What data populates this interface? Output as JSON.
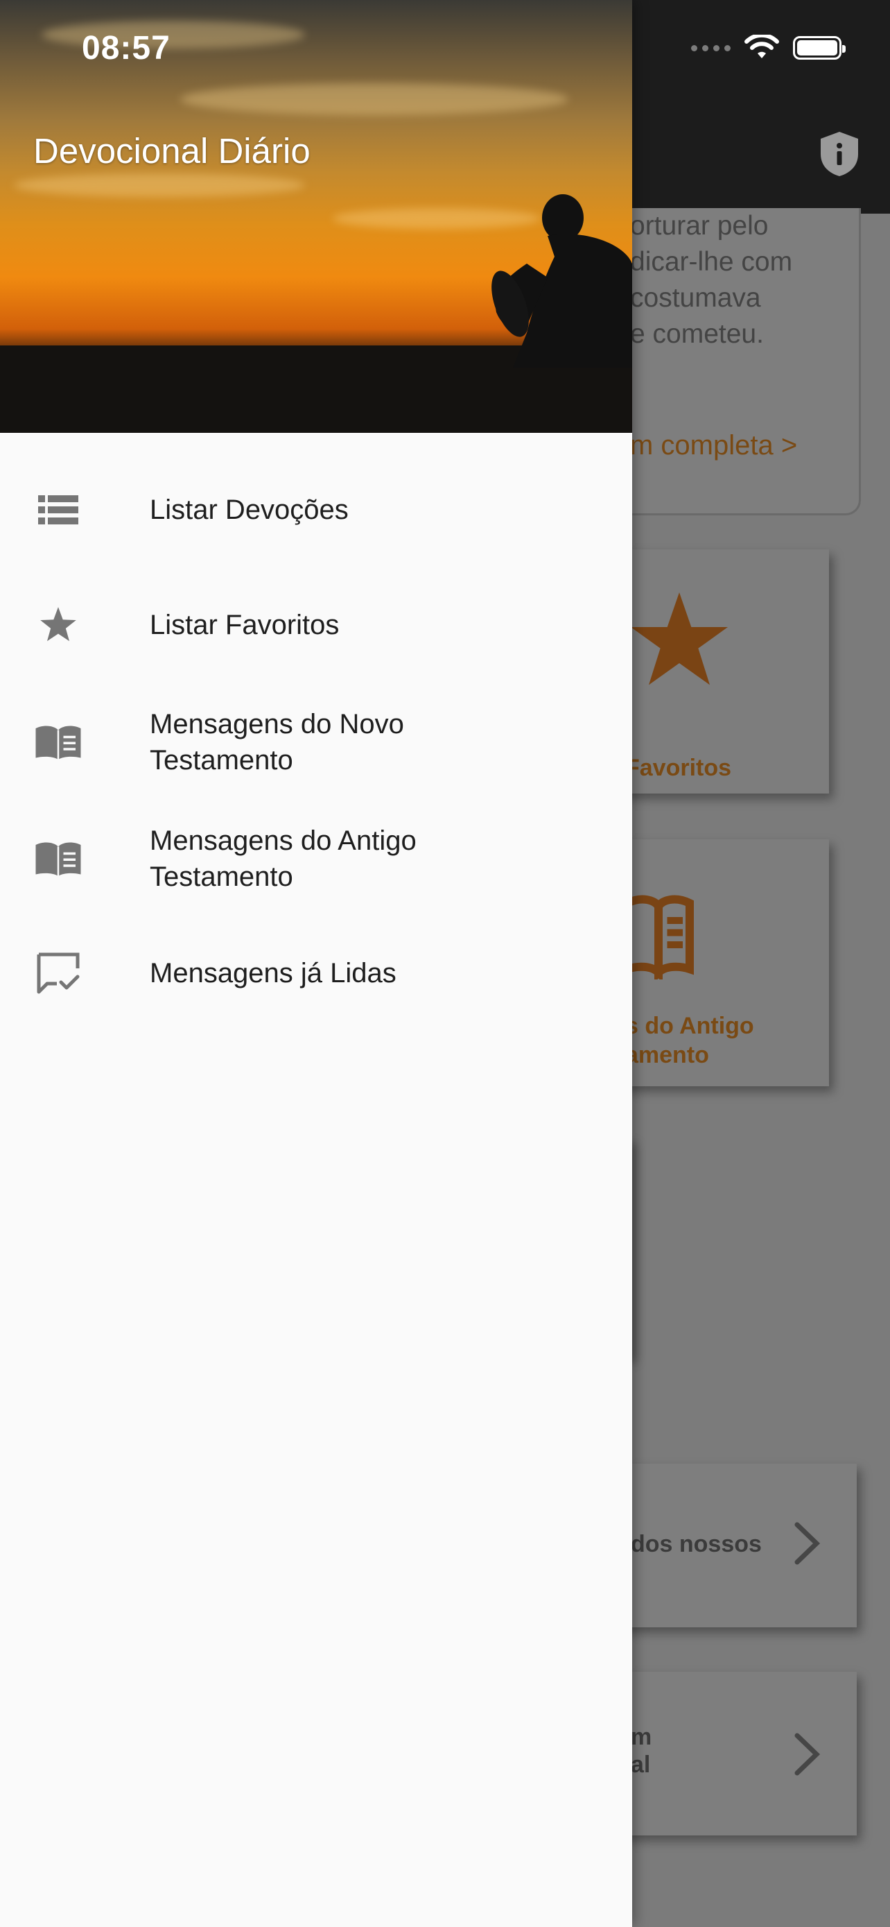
{
  "status_bar": {
    "time": "08:57"
  },
  "drawer": {
    "title": "Devocional Diário",
    "items": [
      {
        "label": "Listar Devoções",
        "icon": "list-icon"
      },
      {
        "label": "Listar Favoritos",
        "icon": "star-icon"
      },
      {
        "label": "Mensagens do Novo\nTestamento",
        "icon": "book-icon"
      },
      {
        "label": "Mensagens do Antigo\nTestamento",
        "icon": "book-icon"
      },
      {
        "label": "Mensagens já Lidas",
        "icon": "message-check-icon"
      }
    ]
  },
  "background": {
    "card_text": "orturar pelo\ndicar-lhe com\ncostumava\ne cometeu.",
    "card_link": "m completa >",
    "tile_favoritos": "Favoritos",
    "tile_antigo": "s do Antigo\namento",
    "row1": "dos nossos",
    "row2": "m\nal"
  },
  "colors": {
    "accent": "#c46a1a",
    "drawer_bg": "#fafafa",
    "icon_grey": "#757575"
  }
}
